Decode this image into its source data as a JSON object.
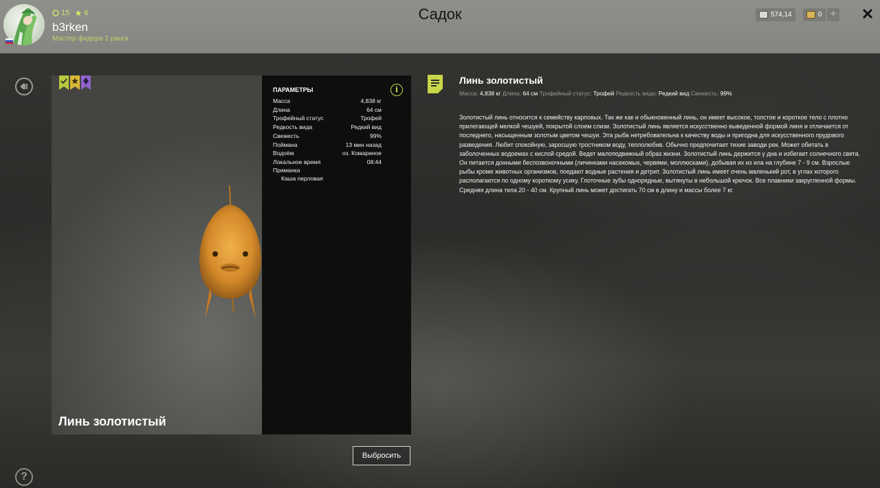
{
  "header": {
    "title": "Садок",
    "user": {
      "name": "b3rken",
      "rank": "Мастер фидера 2 ранга",
      "level": "15",
      "stars": "6"
    },
    "currency": {
      "silver": "574,14",
      "gold": "0"
    },
    "icons": [
      "avatar",
      "flag-russia-icon",
      "level-icon",
      "star-icon",
      "silver-coin-icon",
      "gold-coin-icon",
      "plus-icon",
      "close-icon"
    ]
  },
  "preview": {
    "fish_name": "Линь золотистый",
    "badges": [
      {
        "name": "checkmark-badge",
        "color": "#b9c93e"
      },
      {
        "name": "star-badge",
        "color": "#d9b93a"
      },
      {
        "name": "diamond-badge",
        "color": "#8f63c9"
      }
    ]
  },
  "params": {
    "title": "ПАРАМЕТРЫ",
    "rows": [
      {
        "label": "Масса",
        "value": "4,838 кг"
      },
      {
        "label": "Длина",
        "value": "64 см"
      },
      {
        "label": "Трофейный статус",
        "value": "Трофей"
      },
      {
        "label": "Редкость вида",
        "value": "Редкий вид"
      },
      {
        "label": "Свежесть",
        "value": "99%"
      },
      {
        "label": "Поймана",
        "value": "13 мин назад"
      },
      {
        "label": "Водоём",
        "value": "оз. Комариное"
      },
      {
        "label": "Локальное время",
        "value": "08:44"
      }
    ],
    "bait_label": "Приманка",
    "bait_value": "Каша перловая"
  },
  "actions": {
    "discard_label": "Выбросить",
    "help_label": "?"
  },
  "description": {
    "title": "Линь золотистый",
    "meta": {
      "mass_label": "Масса:",
      "mass_value": "4,838 кг",
      "length_label": "Длина:",
      "length_value": "64 см",
      "trophy_label": "Трофейный статус:",
      "trophy_value": "Трофей",
      "rarity_label": "Редкость вида:",
      "rarity_value": "Редкий вид",
      "fresh_label": "Свежесть:",
      "fresh_value": "99%"
    },
    "text": "Золотистый линь относится к семейству карповых. Так же как и обыкновенный линь, он имеет высокое, толстое и короткое тело с плотно прилегающей мелкой чешуей, покрытой слоем слизи. Золотистый линь является искусственно выведенной формой линя и отличается от последнего, насыщенным золотым цветом чешуи. Эта рыба нетребовательна к качеству воды и пригодна для искусственного прудового разведения. Любит спокойную, заросшую тростником воду, теплолюбив. Обычно предпочитает тихие заводи рек. Может обитать в заболоченных водоемах с кислой средой. Ведет малоподвижный образ жизни. Золотистый линь держится у дна и избегает солнечного света. Он питается донными беспозвоночными (личинками насекомых, червями, моллюсками), добывая их из ила на глубине 7 - 9 см. Взрослые рыбы кроме животных организмов, поедают водные растения и детрит. Золотистый линь имеет очень маленький рот, в углах которого располагается по одному короткому усику. Глоточные зубы однорядные, вытянуты в небольшой крючок. Все плавники закругленной формы. Средняя длина тела 20 - 40 см. Крупный линь может достигать 70 см в длину и массы более 7 кг."
  },
  "colors": {
    "accent": "#c9d64a",
    "header_bg": "#8f8f8c",
    "panel_bg": "#0e0e0e"
  }
}
